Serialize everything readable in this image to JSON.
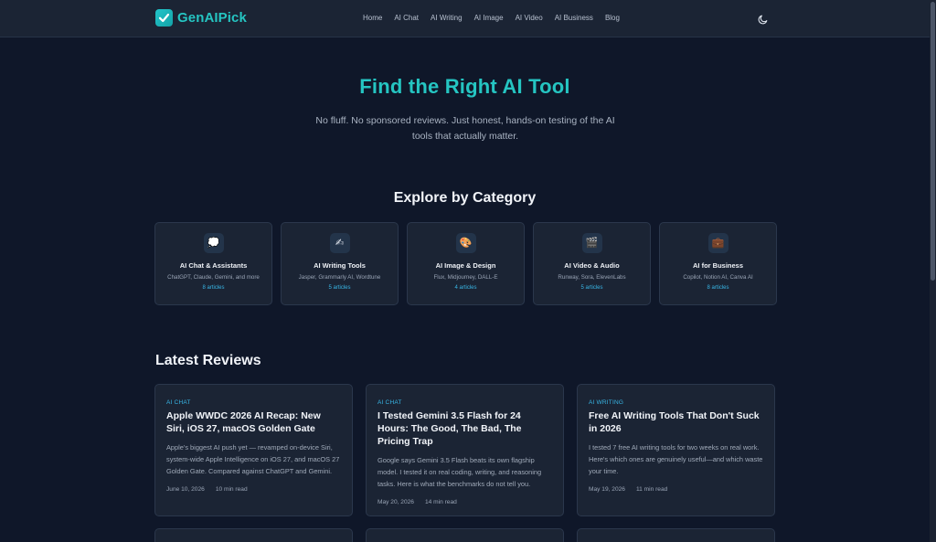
{
  "brand": {
    "name": "GenAIPick",
    "accent": "#25c5c2"
  },
  "nav": [
    "Home",
    "AI Chat",
    "AI Writing",
    "AI Image",
    "AI Video",
    "AI Business",
    "Blog"
  ],
  "theme_icon": "moon-icon",
  "hero": {
    "title": "Find the Right AI Tool",
    "subtitle": "No fluff. No sponsored reviews. Just honest, hands-on testing of the AI tools that actually matter."
  },
  "categories": {
    "title": "Explore by Category",
    "items": [
      {
        "icon": "speech-bubble-icon",
        "glyph": "💭",
        "name": "AI Chat & Assistants",
        "desc": "ChatGPT, Claude, Gemini, and more",
        "count": "8 articles"
      },
      {
        "icon": "writing-hand-icon",
        "glyph": "✍",
        "name": "AI Writing Tools",
        "desc": "Jasper, Grammarly AI, Wordtune",
        "count": "5 articles"
      },
      {
        "icon": "palette-icon",
        "glyph": "🎨",
        "name": "AI Image & Design",
        "desc": "Flux, Midjourney, DALL-E",
        "count": "4 articles"
      },
      {
        "icon": "clapper-icon",
        "glyph": "🎬",
        "name": "AI Video & Audio",
        "desc": "Runway, Sora, ElevenLabs",
        "count": "5 articles"
      },
      {
        "icon": "briefcase-icon",
        "glyph": "💼",
        "name": "AI for Business",
        "desc": "Copilot, Notion AI, Canva AI",
        "count": "8 articles"
      }
    ]
  },
  "reviews": {
    "title": "Latest Reviews",
    "items": [
      {
        "category": "AI CHAT",
        "title": "Apple WWDC 2026 AI Recap: New Siri, iOS 27, macOS Golden Gate",
        "excerpt": "Apple's biggest AI push yet — revamped on-device Siri, system-wide Apple Intelligence on iOS 27, and macOS 27 Golden Gate. Compared against ChatGPT and Gemini.",
        "date": "June 10, 2026",
        "read": "10 min read"
      },
      {
        "category": "AI CHAT",
        "title": "I Tested Gemini 3.5 Flash for 24 Hours: The Good, The Bad, The Pricing Trap",
        "excerpt": "Google says Gemini 3.5 Flash beats its own flagship model. I tested it on real coding, writing, and reasoning tasks. Here is what the benchmarks do not tell you.",
        "date": "May 20, 2026",
        "read": "14 min read"
      },
      {
        "category": "AI WRITING",
        "title": "Free AI Writing Tools That Don't Suck in 2026",
        "excerpt": "I tested 7 free AI writing tools for two weeks on real work. Here's which ones are genuinely useful—and which waste your time.",
        "date": "May 19, 2026",
        "read": "11 min read"
      }
    ]
  }
}
